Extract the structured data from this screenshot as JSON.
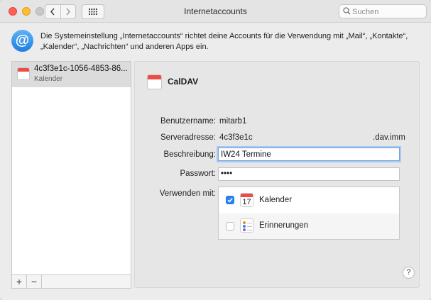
{
  "window": {
    "title": "Internetaccounts",
    "search_placeholder": "Suchen",
    "nav_back": "‹",
    "nav_forward": "›"
  },
  "header": {
    "description": "Die Systemeinstellung „Internetaccounts“ richtet deine Accounts für die Verwendung mit „Mail“, „Kontakte“, „Kalender“, „Nachrichten“ und anderen Apps ein."
  },
  "accounts": [
    {
      "title": "4c3f3e1c-1056-4853-86...",
      "subtitle": "Kalender",
      "selected": true
    }
  ],
  "list_footer": {
    "add_label": "+",
    "remove_label": "−"
  },
  "detail": {
    "account_type": "CalDAV",
    "fields": {
      "username_label": "Benutzername:",
      "username_value": "mitarb1",
      "server_label": "Serveradresse:",
      "server_value_left": "4c3f3e1c",
      "server_value_right": ".dav.imm",
      "description_label": "Beschreibung:",
      "description_value": "IW24 Termine",
      "password_label": "Passwort:",
      "password_value": "••••",
      "use_with_label": "Verwenden mit:"
    },
    "apps": [
      {
        "name": "Kalender",
        "enabled": true,
        "icon": "calendar-icon",
        "icon_text": "17"
      },
      {
        "name": "Erinnerungen",
        "enabled": false,
        "icon": "reminders-icon"
      }
    ],
    "help_label": "?"
  },
  "colors": {
    "accent": "#2a82f4",
    "calendar_red": "#ee4b46",
    "focus_ring": "#a9c9f2"
  }
}
